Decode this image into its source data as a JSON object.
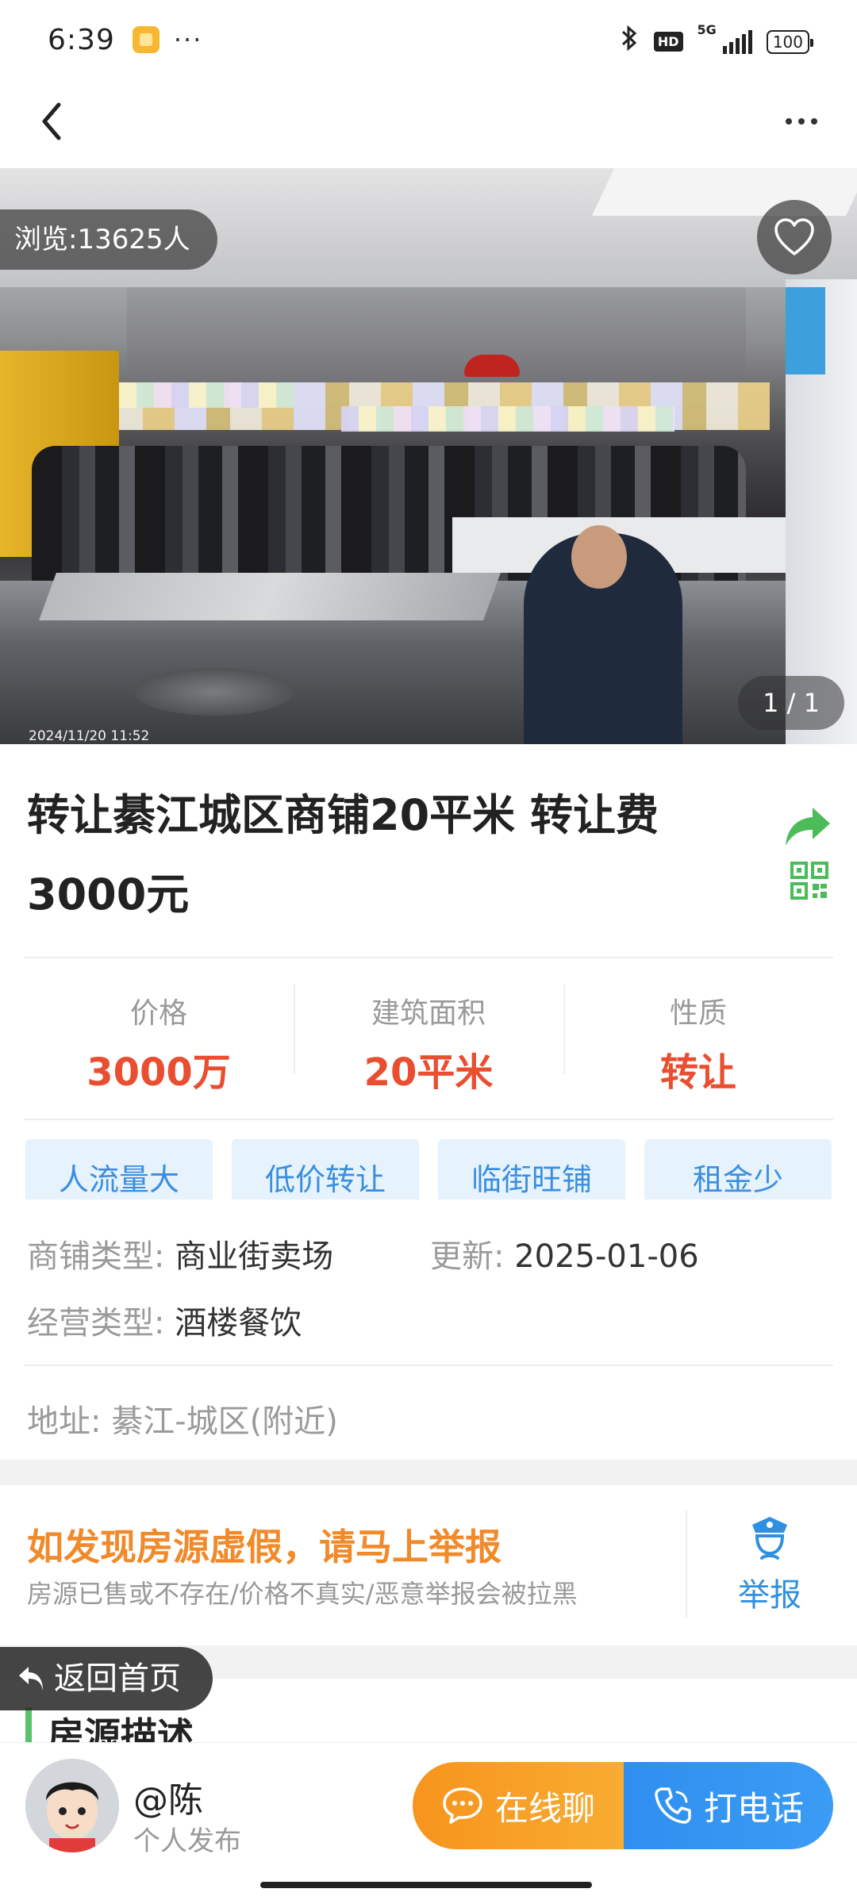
{
  "status_bar": {
    "time": "6:39",
    "dots": "···",
    "hd": "HD",
    "network": "5G",
    "battery": "100"
  },
  "hero": {
    "view_count": "浏览:13625人",
    "page_indicator": "1 / 1",
    "photo_date": "2024/11/20 11:52"
  },
  "listing": {
    "title": "转让綦江城区商铺20平米 转让费3000元",
    "stats": [
      {
        "label": "价格",
        "value": "3000万"
      },
      {
        "label": "建筑面积",
        "value": "20平米"
      },
      {
        "label": "性质",
        "value": "转让"
      }
    ],
    "tags": [
      "人流量大",
      "低价转让",
      "临街旺铺",
      "租金少"
    ],
    "shop_type_label": "商铺类型:",
    "shop_type_value": "商业街卖场",
    "updated_label": "更新:",
    "updated_value": "2025-01-06",
    "business_type_label": "经营类型:",
    "business_type_value": "酒楼餐饮",
    "address_label": "地址:",
    "address_value": "綦江-城区(附近)"
  },
  "report": {
    "title": "如发现房源虚假，请马上举报",
    "subtitle": "房源已售或不存在/价格不真实/恶意举报会被拉黑",
    "button_label": "举报"
  },
  "description": {
    "title": "房源描述"
  },
  "back_home": {
    "label": "返回首页"
  },
  "bottom_bar": {
    "user_name": "@陈",
    "user_type": "个人发布",
    "chat_label": "在线聊",
    "call_label": "打电话"
  },
  "colors": {
    "accent_red": "#e94e30",
    "tag_bg": "#e6f2fc",
    "tag_text": "#3a8ee0",
    "report_orange": "#f08a2a",
    "chat_orange": "#f7941d",
    "call_blue": "#2e8ff0",
    "desc_green": "#58c36c"
  },
  "icons": [
    "back-arrow-icon",
    "more-icon",
    "heart-icon",
    "share-icon",
    "qr-code-icon",
    "police-icon",
    "return-arrow-icon",
    "chat-bubble-icon",
    "phone-icon",
    "bluetooth-icon"
  ]
}
